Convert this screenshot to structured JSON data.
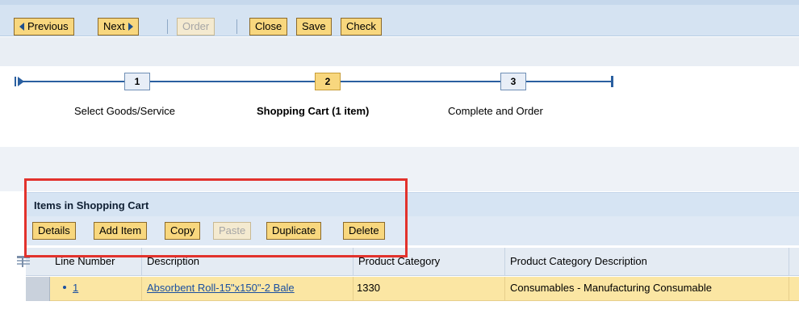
{
  "toolbar": {
    "previous_label": "Previous",
    "next_label": "Next",
    "order_label": "Order",
    "close_label": "Close",
    "save_label": "Save",
    "check_label": "Check"
  },
  "roadmap": {
    "steps": [
      {
        "number": "1",
        "label": "Select Goods/Service",
        "active": false
      },
      {
        "number": "2",
        "label": "Shopping Cart (1 item)",
        "active": true
      },
      {
        "number": "3",
        "label": "Complete and Order",
        "active": false
      }
    ]
  },
  "items_panel": {
    "title": "Items in Shopping Cart",
    "buttons": {
      "details": "Details",
      "add_item": "Add Item",
      "copy": "Copy",
      "paste": "Paste",
      "duplicate": "Duplicate",
      "delete": "Delete"
    }
  },
  "table": {
    "columns": [
      "Line Number",
      "Description",
      "Product Category",
      "Product Category Description"
    ],
    "rows": [
      {
        "line_number": "1",
        "description": "Absorbent Roll-15\"x150\"-2 Bale",
        "product_category": "1330",
        "product_category_description": "Consumables - Manufacturing Consumable"
      }
    ]
  },
  "colors": {
    "button_bg": "#f8d77e",
    "header_blue": "#d6e4f3",
    "selected_row": "#fbe6a3",
    "highlight_border": "#e2322c",
    "link": "#1a4fa0"
  }
}
